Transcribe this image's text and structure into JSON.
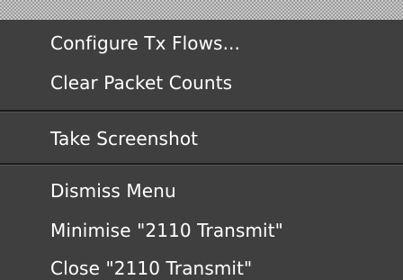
{
  "menu": {
    "items": [
      {
        "label": "Configure Tx Flows..."
      },
      {
        "label": "Clear Packet Counts"
      },
      {
        "label": "Take Screenshot"
      },
      {
        "label": "Dismiss Menu"
      },
      {
        "label": "Minimise \"2110 Transmit\""
      },
      {
        "label": "Close \"2110 Transmit\""
      }
    ]
  }
}
